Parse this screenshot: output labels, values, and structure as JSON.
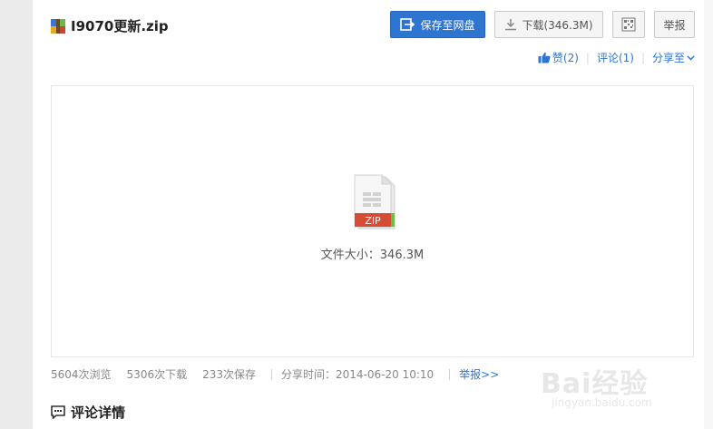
{
  "file": {
    "title": "I9070更新.zip",
    "size_label": "文件大小：346.3M",
    "icon_label": "ZIP"
  },
  "toolbar": {
    "save_label": "保存至网盘",
    "download_label": "下载(346.3M)",
    "report_label": "举报"
  },
  "actions": {
    "like_label": "赞(2)",
    "comment_label": "评论(1)",
    "share_label": "分享至"
  },
  "stats": {
    "views": "5604次浏览",
    "downloads": "5306次下载",
    "saves": "233次保存",
    "share_time": "分享时间：2014-06-20 10:10",
    "report_link": "举报>>"
  },
  "comments": {
    "header": "评论详情"
  },
  "watermark": {
    "text": "Bai经验",
    "sub": "jingyan.baidu.com"
  },
  "colors": {
    "accent": "#2e74d1",
    "zip_red": "#d54b34",
    "zip_green": "#6cbd45"
  }
}
